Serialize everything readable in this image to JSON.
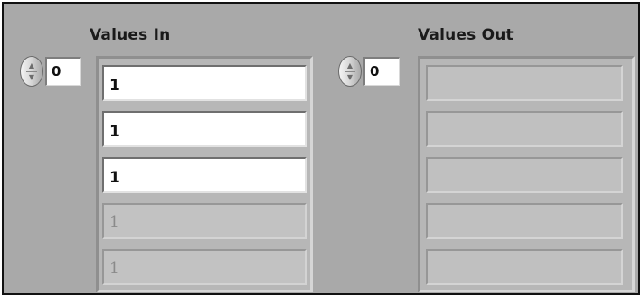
{
  "values_in": {
    "label": "Values In",
    "index": "0",
    "elements": [
      {
        "value": "1",
        "state": "active"
      },
      {
        "value": "1",
        "state": "active"
      },
      {
        "value": "1",
        "state": "active"
      },
      {
        "value": "1",
        "state": "inactive"
      },
      {
        "value": "1",
        "state": "inactive"
      }
    ]
  },
  "values_out": {
    "label": "Values Out",
    "index": "0",
    "elements": [
      {
        "value": "",
        "state": "inactive"
      },
      {
        "value": "",
        "state": "inactive"
      },
      {
        "value": "",
        "state": "inactive"
      },
      {
        "value": "",
        "state": "inactive"
      },
      {
        "value": "",
        "state": "inactive"
      }
    ]
  },
  "colors": {
    "panel_background": "#a9a9a9",
    "active_cell": "#ffffff",
    "inactive_cell": "#c2c2c2"
  },
  "icons": {
    "index_spinner": "up-down-spinner-icon"
  }
}
